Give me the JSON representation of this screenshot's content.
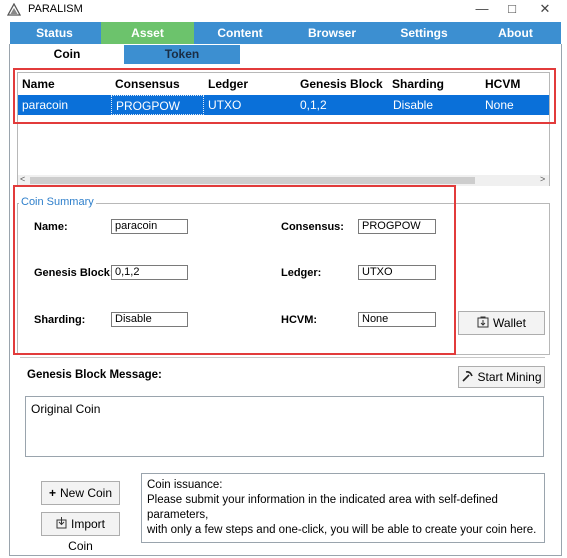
{
  "window": {
    "title": "PARALISM",
    "minimize": "—",
    "maximize": "□",
    "close": "✕"
  },
  "main_tabs": [
    {
      "label": "Status",
      "active": false
    },
    {
      "label": "Asset",
      "active": true
    },
    {
      "label": "Content",
      "active": false
    },
    {
      "label": "Browser",
      "active": false
    },
    {
      "label": "Settings",
      "active": false
    },
    {
      "label": "About",
      "active": false
    }
  ],
  "sub_tabs": [
    {
      "label": "Coin",
      "active": true
    },
    {
      "label": "Token",
      "active": false
    }
  ],
  "grid": {
    "columns": [
      "Name",
      "Consensus",
      "Ledger",
      "Genesis Block",
      "Sharding",
      "HCVM"
    ],
    "rows": [
      [
        "paracoin",
        "PROGPOW",
        "UTXO",
        "0,1,2",
        "Disable",
        "None"
      ]
    ],
    "scroll_left": "<",
    "scroll_right": ">"
  },
  "summary": {
    "group_title": "Coin Summary",
    "name_label": "Name:",
    "name_value": "paracoin",
    "consensus_label": "Consensus:",
    "consensus_value": "PROGPOW",
    "genesis_label": "Genesis Block:",
    "genesis_value": "0,1,2",
    "ledger_label": "Ledger:",
    "ledger_value": "UTXO",
    "sharding_label": "Sharding:",
    "sharding_value": "Disable",
    "hcvm_label": "HCVM:",
    "hcvm_value": "None",
    "wallet_button": "Wallet"
  },
  "genesis_message": {
    "label": "Genesis Block Message:",
    "start_mining_button": "Start Mining",
    "text": "Original Coin"
  },
  "actions": {
    "new_coin_button": "New Coin",
    "import_coin_button": "Import Coin"
  },
  "info": {
    "line1": "Coin issuance:",
    "line2": "Please submit your information in the indicated area with self-defined parameters,",
    "line3": "with only a few steps and one-click, you will be able to create your coin here."
  },
  "colors": {
    "tab_bar": "#3c8fd1",
    "tab_active": "#6cc36c",
    "selection": "#0a70d9",
    "highlight_red": "#e23b3b",
    "group_title": "#2e7fcb"
  }
}
